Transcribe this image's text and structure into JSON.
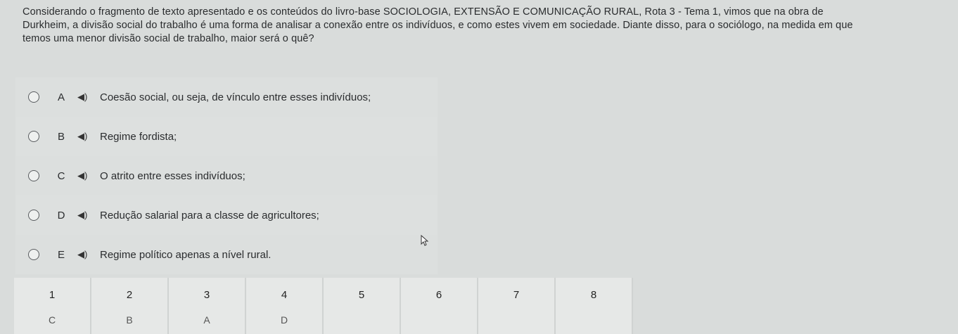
{
  "question": {
    "lines": [
      "Considerando o fragmento de texto apresentado e os conteúdos do livro-base SOCIOLOGIA, EXTENSÃO E COMUNICAÇÃO RURAL, Rota 3 - Tema 1, vimos que na obra de",
      "Durkheim, a divisão social do trabalho é uma forma de analisar a conexão entre os indivíduos, e como estes vivem em sociedade. Diante disso, para o sociólogo, na medida em que",
      "temos uma menor divisão social de trabalho, maior será o quê?"
    ]
  },
  "options": [
    {
      "letter": "A",
      "text": "Coesão social, ou seja, de vínculo entre esses indivíduos;"
    },
    {
      "letter": "B",
      "text": "Regime fordista;"
    },
    {
      "letter": "C",
      "text": "O atrito entre esses indivíduos;"
    },
    {
      "letter": "D",
      "text": "Redução salarial para a classe de agricultores;"
    },
    {
      "letter": "E",
      "text": "Regime político apenas a nível rural."
    }
  ],
  "speaker_icon": "speaker-icon",
  "nav": [
    {
      "num": "1",
      "ans": "C"
    },
    {
      "num": "2",
      "ans": "B"
    },
    {
      "num": "3",
      "ans": "A"
    },
    {
      "num": "4",
      "ans": "D"
    },
    {
      "num": "5",
      "ans": ""
    },
    {
      "num": "6",
      "ans": ""
    },
    {
      "num": "7",
      "ans": ""
    },
    {
      "num": "8",
      "ans": ""
    }
  ]
}
